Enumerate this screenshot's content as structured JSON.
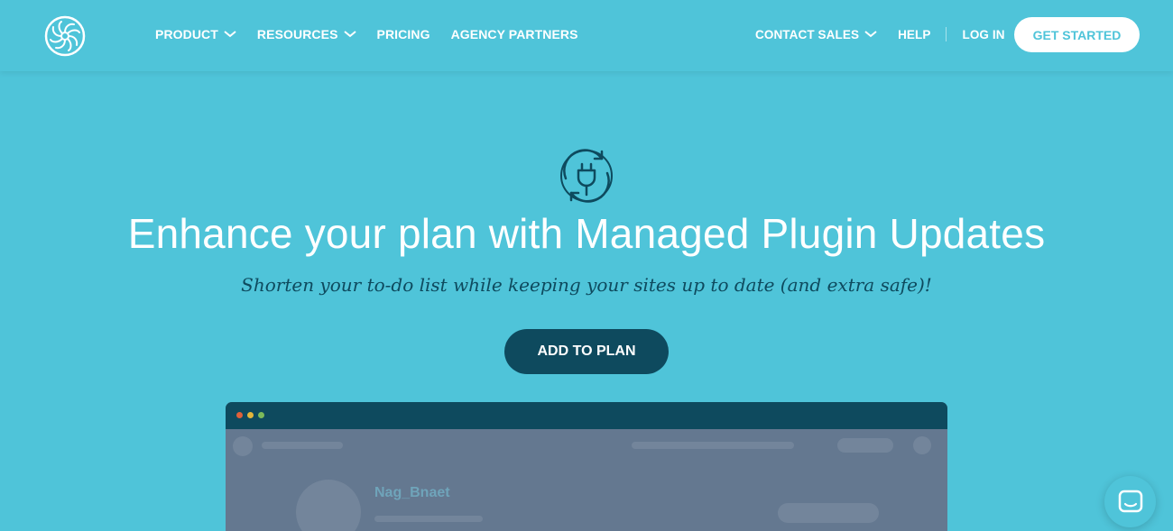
{
  "nav": {
    "logo_icon": "spiral-logo-icon",
    "left_items": [
      {
        "label": "PRODUCT",
        "has_dropdown": true
      },
      {
        "label": "RESOURCES",
        "has_dropdown": true
      },
      {
        "label": "PRICING",
        "has_dropdown": false
      },
      {
        "label": "AGENCY PARTNERS",
        "has_dropdown": false
      }
    ],
    "contact_sales": "CONTACT SALES",
    "help": "HELP",
    "log_in": "LOG IN",
    "get_started": "GET STARTED"
  },
  "hero": {
    "icon": "plugin-refresh-icon",
    "title": "Enhance your plan with Managed Plugin Updates",
    "subtitle": "Shorten your to-do list while keeping your sites up to date (and extra safe)!",
    "cta": "ADD TO PLAN"
  },
  "mockup": {
    "user_name": "Nag_Bnaet"
  },
  "chat": {
    "icon": "chat-bubble-icon"
  },
  "colors": {
    "background": "#4fc4d9",
    "dark_teal": "#0e4a5e",
    "white": "#ffffff"
  }
}
